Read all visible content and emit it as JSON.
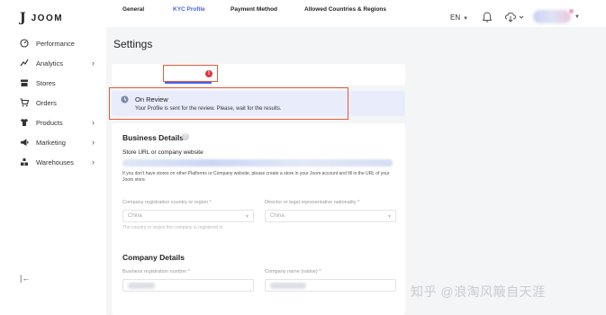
{
  "header": {
    "brand": "JOOM",
    "language": "EN"
  },
  "sidebar": {
    "items": [
      {
        "label": "Performance",
        "icon": "gauge-icon",
        "has_children": false
      },
      {
        "label": "Analytics",
        "icon": "analytics-icon",
        "has_children": true
      },
      {
        "label": "Stores",
        "icon": "store-icon",
        "has_children": false
      },
      {
        "label": "Orders",
        "icon": "cart-icon",
        "has_children": false
      },
      {
        "label": "Products",
        "icon": "shirt-icon",
        "has_children": true
      },
      {
        "label": "Marketing",
        "icon": "megaphone-icon",
        "has_children": true
      },
      {
        "label": "Warehouses",
        "icon": "warehouse-icon",
        "has_children": true
      }
    ]
  },
  "page": {
    "title": "Settings"
  },
  "tabs": {
    "general": "General",
    "kyc": "KYC Profile",
    "payment": "Payment Method",
    "allowed": "Allowed Countries & Regions"
  },
  "review": {
    "title": "On Review",
    "message": "Your Profile is sent for the review. Please, wait for the results."
  },
  "business": {
    "title": "Business Details",
    "store_url_label": "Store URL or company website",
    "help_text": "If you don't have stores on other Platforms or Company website, please create a store in your Joom account and fill in the URL of your Joom store.",
    "country_label": "Company registration country or region *",
    "country_value": "China",
    "director_label": "Director or legal representative nationality *",
    "director_value": "China",
    "country_hint": "The country or region the company is registered in"
  },
  "company": {
    "title": "Company Details",
    "reg_number_label": "Business registration number *",
    "name_label": "Company name (native) *"
  },
  "watermark": "知乎 @浪淘风簸自天涯",
  "colors": {
    "accent": "#4a5ff0",
    "highlight_box": "#e55a3c",
    "banner_bg": "#e9edfb",
    "warning_badge": "#d9373e"
  }
}
